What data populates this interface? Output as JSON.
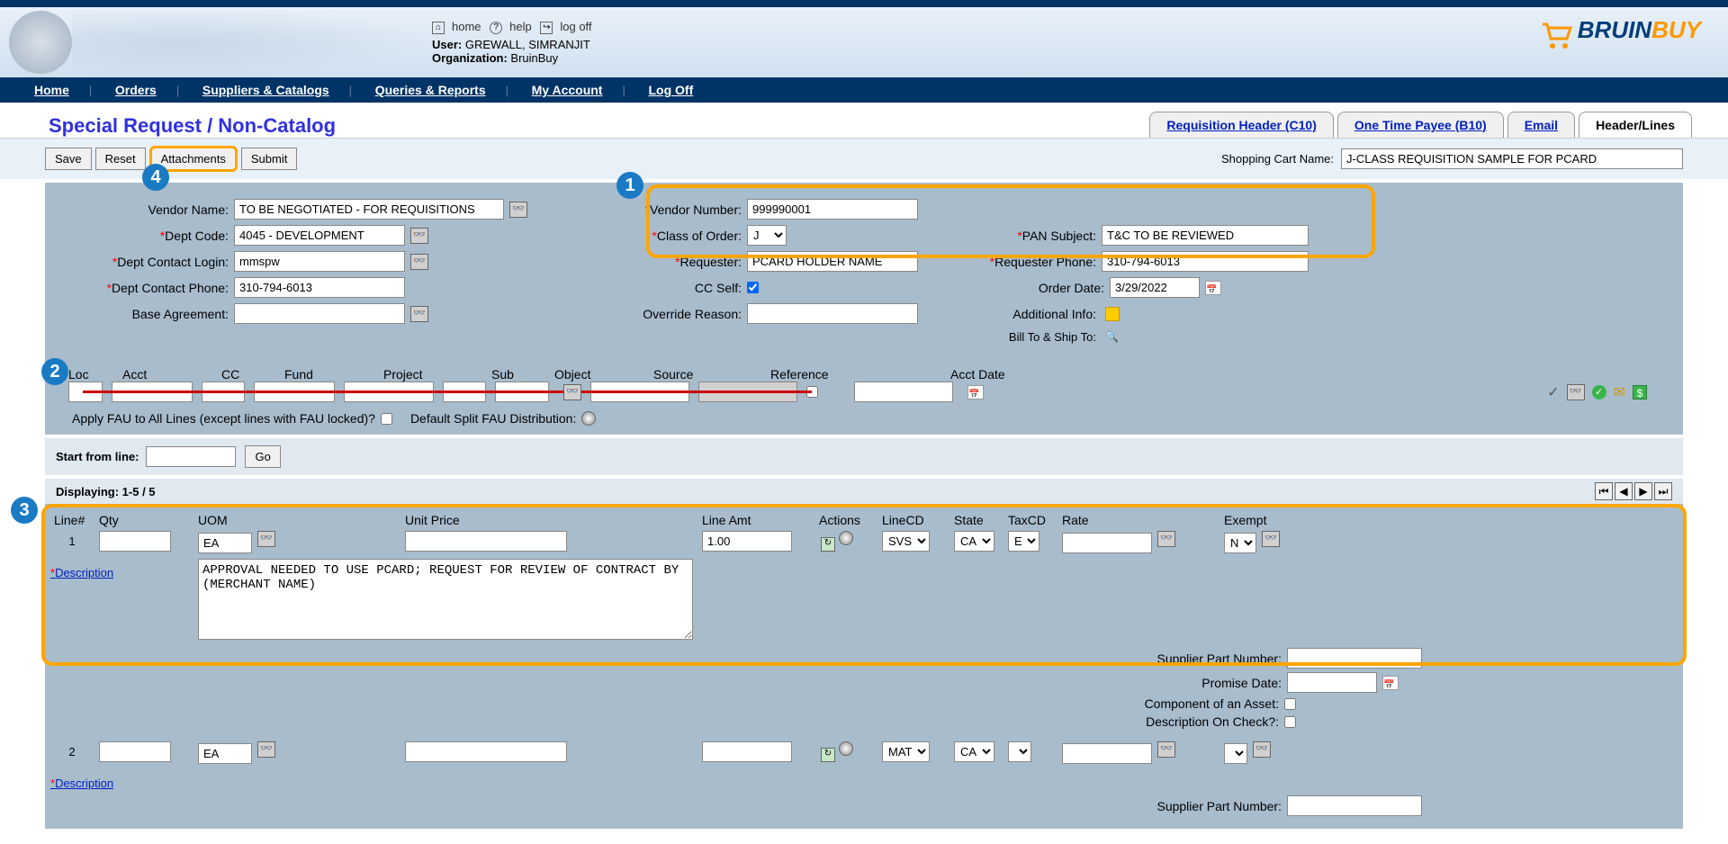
{
  "header": {
    "home": "home",
    "help": "help",
    "logoff": "log off",
    "user_label": "User:",
    "user": "GREWALL, SIMRANJIT",
    "org_label": "Organization:",
    "org": "BruinBuy",
    "logo_brand": "BRUIN",
    "logo_brand2": "BUY"
  },
  "nav": {
    "home": "Home",
    "orders": "Orders",
    "suppliers": "Suppliers & Catalogs",
    "queries": "Queries & Reports",
    "account": "My Account",
    "logoff": "Log Off"
  },
  "page_title": "Special Request / Non-Catalog",
  "tabs": {
    "req": "Requisition Header (C10)",
    "otp": "One Time Payee (B10)",
    "email": "Email",
    "hl": "Header/Lines"
  },
  "toolbar": {
    "save": "Save",
    "reset": "Reset",
    "attach": "Attachments",
    "submit": "Submit",
    "cart_label": "Shopping Cart Name:",
    "cart_value": "J-CLASS REQUISITION SAMPLE FOR PCARD"
  },
  "form": {
    "vendor_name_l": "Vendor Name:",
    "vendor_name": "TO BE NEGOTIATED - FOR REQUISITIONS",
    "dept_code_l": "Dept Code:",
    "dept_code": "4045 - DEVELOPMENT",
    "dept_contact_l": "Dept Contact Login:",
    "dept_contact": "mmspw",
    "dept_phone_l": "Dept Contact Phone:",
    "dept_phone": "310-794-6013",
    "base_agree_l": "Base Agreement:",
    "base_agree": "",
    "vendor_num_l": "Vendor Number:",
    "vendor_num": "999990001",
    "class_l": "Class of Order:",
    "class": "J",
    "pan_l": "PAN Subject:",
    "pan": "T&C TO BE REVIEWED",
    "requester_l": "Requester:",
    "requester": "PCARD HOLDER NAME",
    "req_phone_l": "Requester Phone:",
    "req_phone": "310-794-6013",
    "cc_l": "CC Self:",
    "order_date_l": "Order Date:",
    "order_date": "3/29/2022",
    "override_l": "Override Reason:",
    "override": "",
    "addinfo_l": "Additional Info:",
    "billship_l": "Bill To & Ship To:"
  },
  "fau": {
    "loc": "Loc",
    "acct": "Acct",
    "cc": "CC",
    "fund": "Fund",
    "project": "Project",
    "sub": "Sub",
    "object": "Object",
    "source": "Source",
    "reference": "Reference",
    "acctdate": "Acct Date",
    "apply_label": "Apply FAU to All Lines (except lines with FAU locked)?",
    "default_split": "Default Split FAU Distribution:"
  },
  "startline": {
    "label": "Start from line:",
    "go": "Go",
    "displaying": "Displaying: 1-5 / 5"
  },
  "headers": {
    "line": "Line#",
    "qty": "Qty",
    "uom": "UOM",
    "unitprice": "Unit Price",
    "lineamt": "Line Amt",
    "actions": "Actions",
    "linecd": "LineCD",
    "state": "State",
    "taxcd": "TaxCD",
    "rate": "Rate",
    "exempt": "Exempt"
  },
  "line1": {
    "num": "1",
    "qty": "",
    "uom": "EA",
    "unitprice": "",
    "lineamt": "1.00",
    "linecd": "SVS",
    "state": "CA",
    "taxcd": "E",
    "rate": "",
    "exempt": "N",
    "desc_link": "Description",
    "desc": "APPROVAL NEEDED TO USE PCARD; REQUEST FOR REVIEW OF CONTRACT BY (MERCHANT NAME)",
    "spn_l": "Supplier Part Number:",
    "spn": "",
    "promise_l": "Promise Date:",
    "promise": "",
    "comp_l": "Component of an Asset:",
    "desc_check_l": "Description On Check?:"
  },
  "line2": {
    "num": "2",
    "qty": "",
    "uom": "EA",
    "unitprice": "",
    "lineamt": "",
    "linecd": "MAT",
    "state": "CA",
    "taxcd": "",
    "rate": "",
    "exempt": "",
    "desc_link": "Description",
    "spn_l": "Supplier Part Number:",
    "spn": ""
  }
}
